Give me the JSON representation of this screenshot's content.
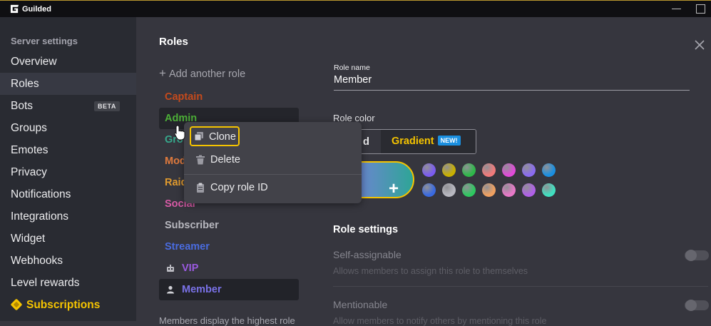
{
  "app": {
    "name": "Guilded"
  },
  "sidebar": {
    "title": "Server settings",
    "items": [
      {
        "label": "Overview"
      },
      {
        "label": "Roles",
        "active": true
      },
      {
        "label": "Bots",
        "badge": "BETA"
      },
      {
        "label": "Groups"
      },
      {
        "label": "Emotes"
      },
      {
        "label": "Privacy"
      },
      {
        "label": "Notifications"
      },
      {
        "label": "Integrations"
      },
      {
        "label": "Widget"
      },
      {
        "label": "Webhooks"
      },
      {
        "label": "Level rewards"
      },
      {
        "label": "Subscriptions",
        "icon": "diamond-icon",
        "color": "#f5c400"
      }
    ]
  },
  "main": {
    "title": "Roles",
    "add_role": "Add another role",
    "roles": [
      {
        "name": "Captain",
        "color": "#c54a1c"
      },
      {
        "name": "Admin",
        "color": "#4caf37"
      },
      {
        "name": "Group",
        "display": "Gro",
        "color": "#36a88c"
      },
      {
        "name": "Mod",
        "display": "Mod",
        "color": "#e07a3d"
      },
      {
        "name": "Raid",
        "display": "Raid",
        "color": "#e09a2e"
      },
      {
        "name": "Social",
        "display": "Social",
        "color": "#d85aa6"
      },
      {
        "name": "Subscriber",
        "color": "#b8b8bf"
      },
      {
        "name": "Streamer",
        "color": "#4a6ce0"
      },
      {
        "name": "VIP",
        "color": "#9a5ae0",
        "icon": "bot-icon"
      },
      {
        "name": "Member",
        "color": "#7a72e8",
        "icon": "person-icon"
      }
    ],
    "footer": "Members display the highest role"
  },
  "context_menu": {
    "items": [
      {
        "label": "Clone",
        "icon": "copy-icon"
      },
      {
        "label": "Delete",
        "icon": "trash-icon"
      },
      {
        "label": "Copy role ID",
        "icon": "clipboard-icon"
      }
    ]
  },
  "editor": {
    "role_name_label": "Role name",
    "role_name_value": "Member",
    "role_color_label": "Role color",
    "color_modes": [
      "Solid",
      "Gradient"
    ],
    "solid_visible": "d",
    "new_badge": "NEW!",
    "swatches_row1": [
      "#7b5cf0",
      "#c9b000",
      "#2fb84a",
      "#f07a7a",
      "#e04ad8",
      "#8a6bf0",
      "#1a8fe0"
    ],
    "swatches_row2": [
      "#3a6ae0",
      "#b8b8c0",
      "#2ec860",
      "#f0a060",
      "#e878c8",
      "#b060e8",
      "#40e0c0"
    ],
    "settings_title": "Role settings",
    "settings": [
      {
        "name": "Self-assignable",
        "description": "Allows members to assign this role to themselves"
      },
      {
        "name": "Mentionable",
        "description": "Allow members to notify others by mentioning this role"
      }
    ]
  }
}
